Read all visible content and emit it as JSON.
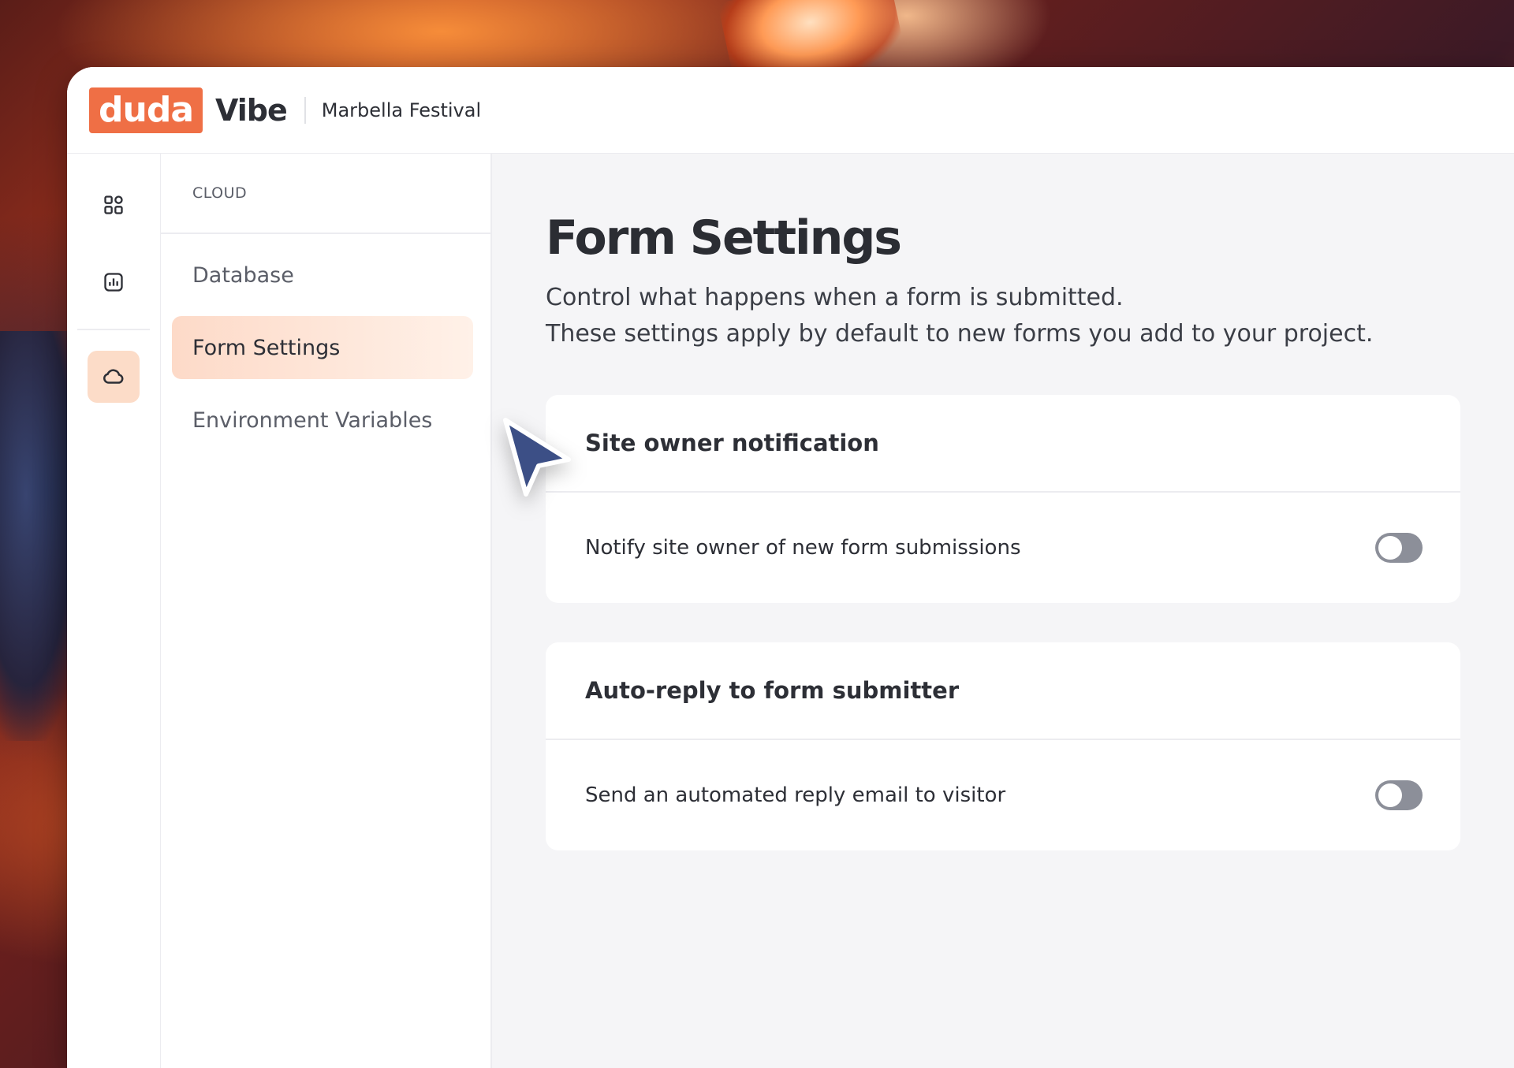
{
  "header": {
    "brand": "duda",
    "product": "Vibe",
    "project": "Marbella Festival"
  },
  "rail": {
    "icons": [
      "dashboard-grid-icon",
      "analytics-chart-icon",
      "cloud-icon"
    ],
    "active": "cloud-icon"
  },
  "nav": {
    "section": "CLOUD",
    "items": [
      {
        "label": "Database"
      },
      {
        "label": "Form Settings"
      },
      {
        "label": "Environment Variables"
      }
    ],
    "active_index": 1
  },
  "main": {
    "title": "Form Settings",
    "description_line1": "Control what happens when a form is submitted.",
    "description_line2": "These settings apply by default to new forms you add to your project.",
    "cards": [
      {
        "title": "Site owner notification",
        "row_label": "Notify site owner of new form submissions",
        "enabled": false
      },
      {
        "title": "Auto-reply to form submitter",
        "row_label": "Send an automated reply email to visitor",
        "enabled": false
      }
    ]
  },
  "colors": {
    "brand": "#ef6f45",
    "active_nav": "#fddac8",
    "toggle_off": "#8c8f99",
    "cursor": "#3c4f86"
  }
}
